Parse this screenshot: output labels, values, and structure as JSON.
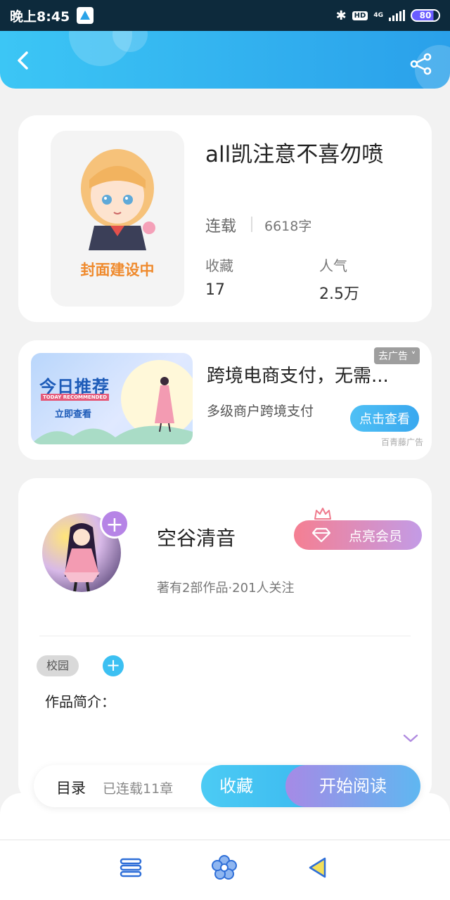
{
  "status_bar": {
    "time": "晚上8:45",
    "hd_label": "HD",
    "network_label": "4G",
    "battery": "80"
  },
  "header": {
    "back_icon": "chevron-left-icon",
    "share_icon": "share-icon"
  },
  "book": {
    "title": "all凯注意不喜勿喷",
    "cover_text": "封面建设中",
    "status": "连载",
    "word_count": "6618字",
    "stats": [
      {
        "label": "收藏",
        "value": "17"
      },
      {
        "label": "人气",
        "value": "2.5万"
      }
    ]
  },
  "ad": {
    "image_title": "今日推荐",
    "image_subtitle": "TODAY RECOMMENDED",
    "image_cta": "立即查看",
    "close_label": "去广告",
    "title": "跨境电商支付，无需...",
    "subtitle": "多级商户跨境支付",
    "button": "点击查看",
    "source": "百青藤广告"
  },
  "author": {
    "name": "空谷清音",
    "meta": "著有2部作品·201人关注",
    "vip_button": "点亮会员",
    "follow_symbol": "+",
    "tag": "校园",
    "tag_add_symbol": "+",
    "intro_label": "作品简介："
  },
  "action_bar": {
    "toc": "目录",
    "chapters": "已连载11章",
    "collect": "收藏",
    "read": "开始阅读"
  },
  "colors": {
    "header_start": "#3cc6f5",
    "header_end": "#2aa0ea",
    "accent_blue": "#3cc0f2",
    "vip_pink": "#f57f92",
    "vip_purple": "#c39be6",
    "cover_text": "#ef8a2d",
    "nav_icon": "#2f6fd8"
  },
  "nav": [
    "menu-icon",
    "flower-home-icon",
    "back-triangle-icon"
  ]
}
